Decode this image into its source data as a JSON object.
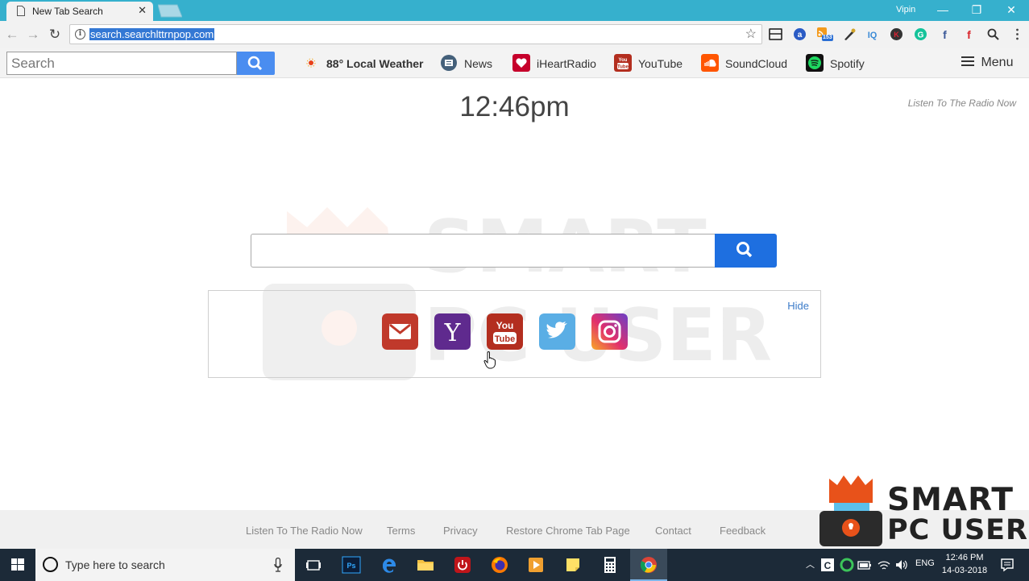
{
  "browser": {
    "tab_title": "New Tab Search",
    "tab_close": "✕",
    "user": "Vipin",
    "window_controls": {
      "minimize": "—",
      "restore": "❐",
      "close": "✕"
    },
    "url": "search.searchlttrnpop.com",
    "nav": {
      "back": "←",
      "forward": "→",
      "reload": "↻"
    },
    "star": "☆",
    "extensions": [
      "layout-icon",
      "a-icon",
      "rss-icon",
      "pen-icon",
      "iq-icon",
      "k-icon",
      "grammarly-icon",
      "facebook-icon",
      "facebook-red-icon",
      "search-icon"
    ],
    "rss_badge": "153"
  },
  "toolbar": {
    "search_placeholder": "Search",
    "links": [
      {
        "label": "88° Local Weather",
        "icon": "weather-icon"
      },
      {
        "label": "News",
        "icon": "news-icon"
      },
      {
        "label": "iHeartRadio",
        "icon": "iheartradio-icon"
      },
      {
        "label": "YouTube",
        "icon": "youtube-icon"
      },
      {
        "label": "SoundCloud",
        "icon": "soundcloud-icon"
      },
      {
        "label": "Spotify",
        "icon": "spotify-icon"
      }
    ],
    "menu_label": "Menu"
  },
  "main": {
    "time": "12:46pm",
    "radio_link": "Listen To The Radio Now",
    "hide_label": "Hide",
    "shortcuts": [
      "gmail-icon",
      "yahoo-icon",
      "youtube-icon",
      "twitter-icon",
      "instagram-icon"
    ]
  },
  "footer": {
    "links": [
      "Listen To The Radio Now",
      "Terms",
      "Privacy",
      "Restore Chrome Tab Page",
      "Contact",
      "Feedback"
    ],
    "brand_line1": "SMART",
    "brand_line2": "PC USER"
  },
  "taskbar": {
    "search_text": "Type here to search",
    "lang": "ENG",
    "time": "12:46 PM",
    "date": "14-03-2018"
  },
  "colors": {
    "titlebar": "#36b0cd",
    "search_button": "#1e6fe0",
    "taskbar": "#1c2a38"
  }
}
